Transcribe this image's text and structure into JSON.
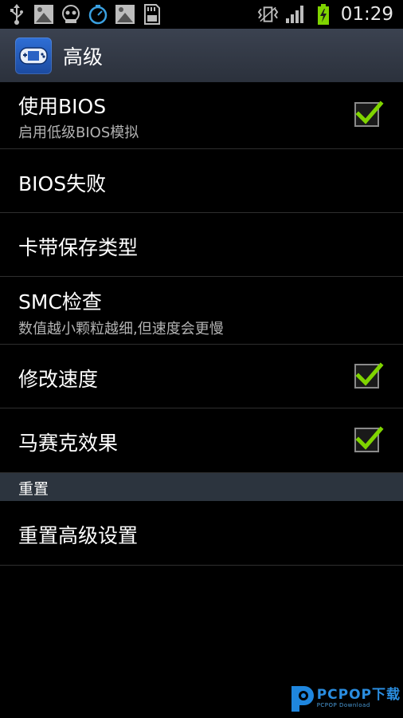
{
  "status_bar": {
    "time": "01:29",
    "icons": [
      "usb-icon",
      "image-notification-icon",
      "game-notification-icon",
      "timer-icon",
      "image-notification-icon",
      "sd-card-icon"
    ],
    "right_icons": [
      "vibrate-icon",
      "signal-icon",
      "battery-charging-icon"
    ]
  },
  "action_bar": {
    "title": "高级",
    "icon": "gba-emulator-app-icon"
  },
  "settings": {
    "use_bios": {
      "title": "使用BIOS",
      "summary": "启用低级BIOS模拟",
      "checked": true
    },
    "bios_fail": {
      "title": "BIOS失败"
    },
    "cart_save_type": {
      "title": "卡带保存类型"
    },
    "smc_check": {
      "title": "SMC检查",
      "summary": "数值越小颗粒越细,但速度会更慢"
    },
    "modify_speed": {
      "title": "修改速度",
      "checked": true
    },
    "mosaic_effect": {
      "title": "马赛克效果",
      "checked": true
    }
  },
  "section_reset": {
    "header": "重置",
    "reset_advanced": {
      "title": "重置高级设置"
    }
  },
  "watermark": {
    "text": "PCPOP下载",
    "sub": "PCPOP Download"
  },
  "colors": {
    "checkmark": "#7fd400",
    "section_header_bg": "#2c343e",
    "action_bar_bg": "#343a46"
  }
}
